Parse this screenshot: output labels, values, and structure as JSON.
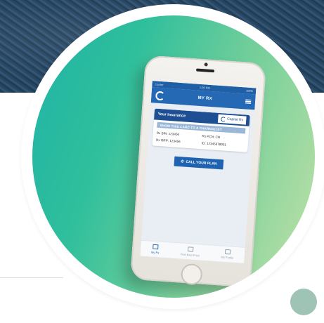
{
  "app": {
    "status_carrier": "Carrier",
    "status_time": "1:20 PM",
    "status_battery": "100%",
    "nav_title": "MY RX"
  },
  "card": {
    "title": "Your Insurance",
    "brand": "Capital Rx",
    "banner": "SHOW THIS CARD TO A PHARMACIST",
    "rx_bin": "Rx BIN: 123456",
    "rx_pcn": "Rx PCN: CR",
    "rx_grp": "Rx GRP: 123456",
    "id": "ID: 12345678901"
  },
  "call_button": "CALL YOUR PLAN",
  "tabs": [
    {
      "label": "My Rx",
      "active": true
    },
    {
      "label": "Find Best Price",
      "active": false
    },
    {
      "label": "My Profile",
      "active": false
    }
  ],
  "colors": {
    "accent": "#2569b5",
    "circle_start": "#1fb3a6",
    "circle_end": "#c2e2a8",
    "dot": "#9fc4b6"
  }
}
